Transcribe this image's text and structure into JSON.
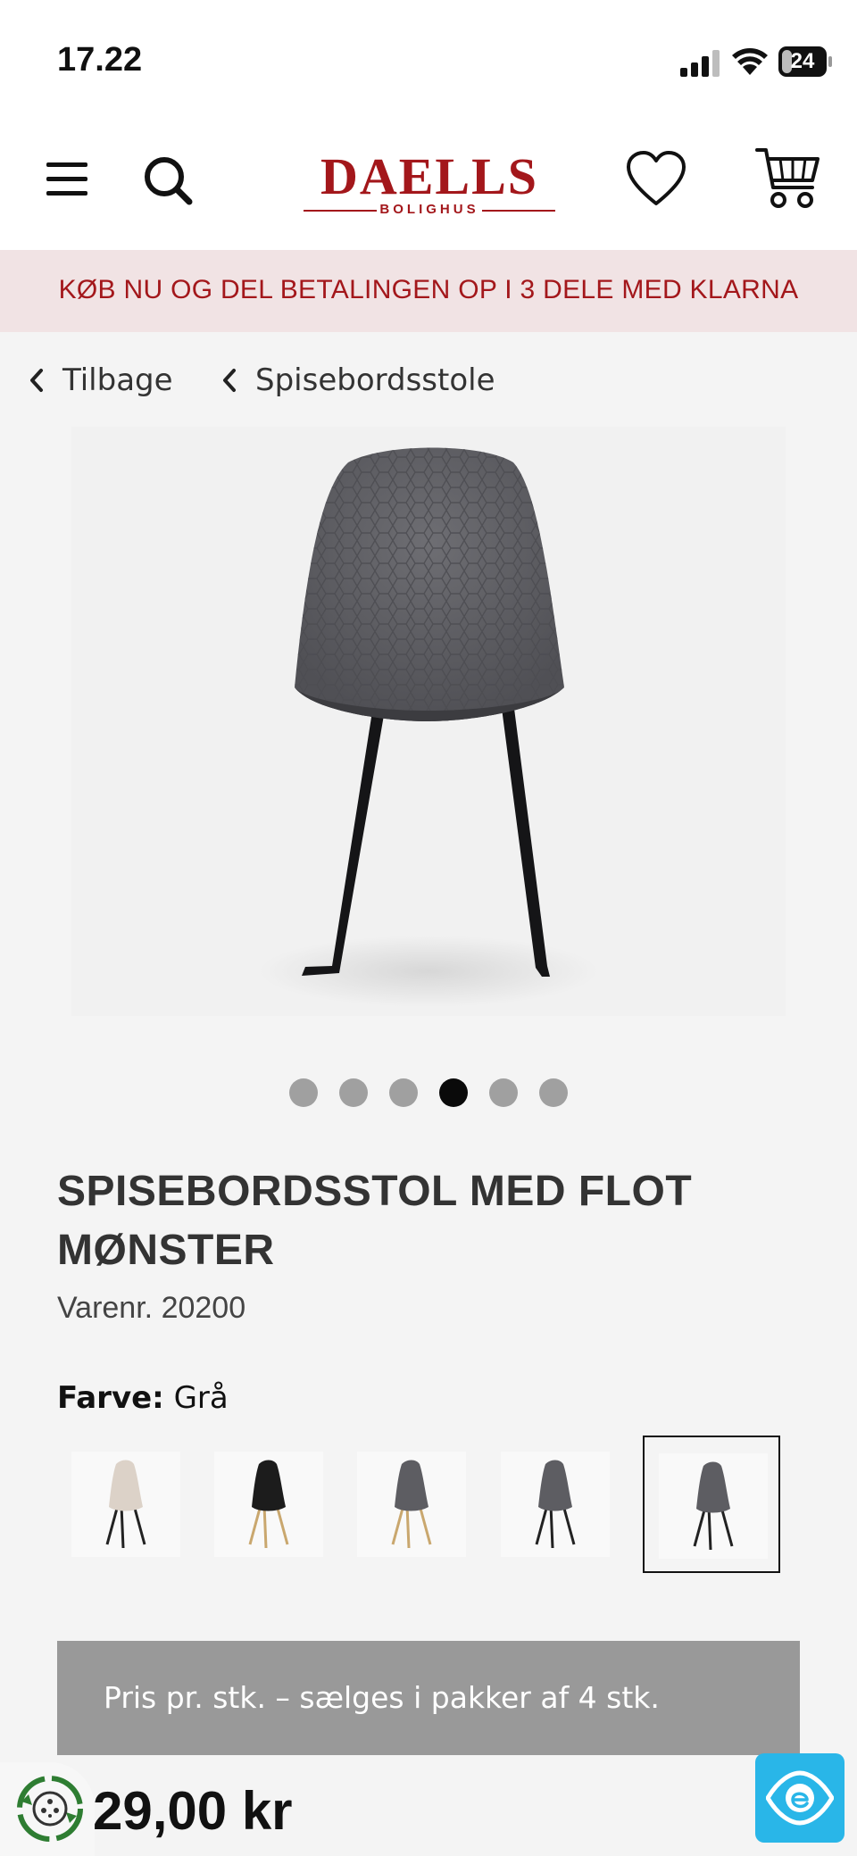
{
  "status_bar": {
    "time": "17.22",
    "battery_level": "24",
    "battery_fraction": 0.24
  },
  "header": {
    "logo_word": "DAELLS",
    "logo_sub": "BOLIGHUS",
    "brand_color": "#a3171b",
    "icons": [
      "menu-icon",
      "search-icon",
      "heart-icon",
      "cart-icon"
    ]
  },
  "promo": {
    "text": "KØB NU OG DEL BETALINGEN OP I 3 DELE MED KLARNA",
    "background": "#f1e3e4"
  },
  "breadcrumb": {
    "back_label": "Tilbage",
    "category_label": "Spisebordsstole"
  },
  "carousel": {
    "total": 6,
    "active_index": 3
  },
  "product": {
    "title": "SPISEBORDSSTOL MED FLOT MØNSTER",
    "sku_label": "Varenr.",
    "sku_number": "20200",
    "color_label": "Farve:",
    "color_value": "Grå",
    "swatches": [
      {
        "seat": "#dcd2c8",
        "legs": "#222222",
        "selected": false
      },
      {
        "seat": "#1c1c1c",
        "legs": "#c9a76e",
        "selected": false
      },
      {
        "seat": "#5d5d62",
        "legs": "#c9a76e",
        "selected": false
      },
      {
        "seat": "#5d5d62",
        "legs": "#222222",
        "selected": false
      },
      {
        "seat": "#5d5d62",
        "legs": "#222222",
        "selected": true
      }
    ],
    "price_info": "Pris pr. stk. – sælges i pakker af 4 stk.",
    "price": "29,00 kr"
  },
  "widgets": {
    "eco_icon": "recycle-badge-icon",
    "eye_icon": "eye-icon",
    "eye_color": "#29b6e8"
  }
}
